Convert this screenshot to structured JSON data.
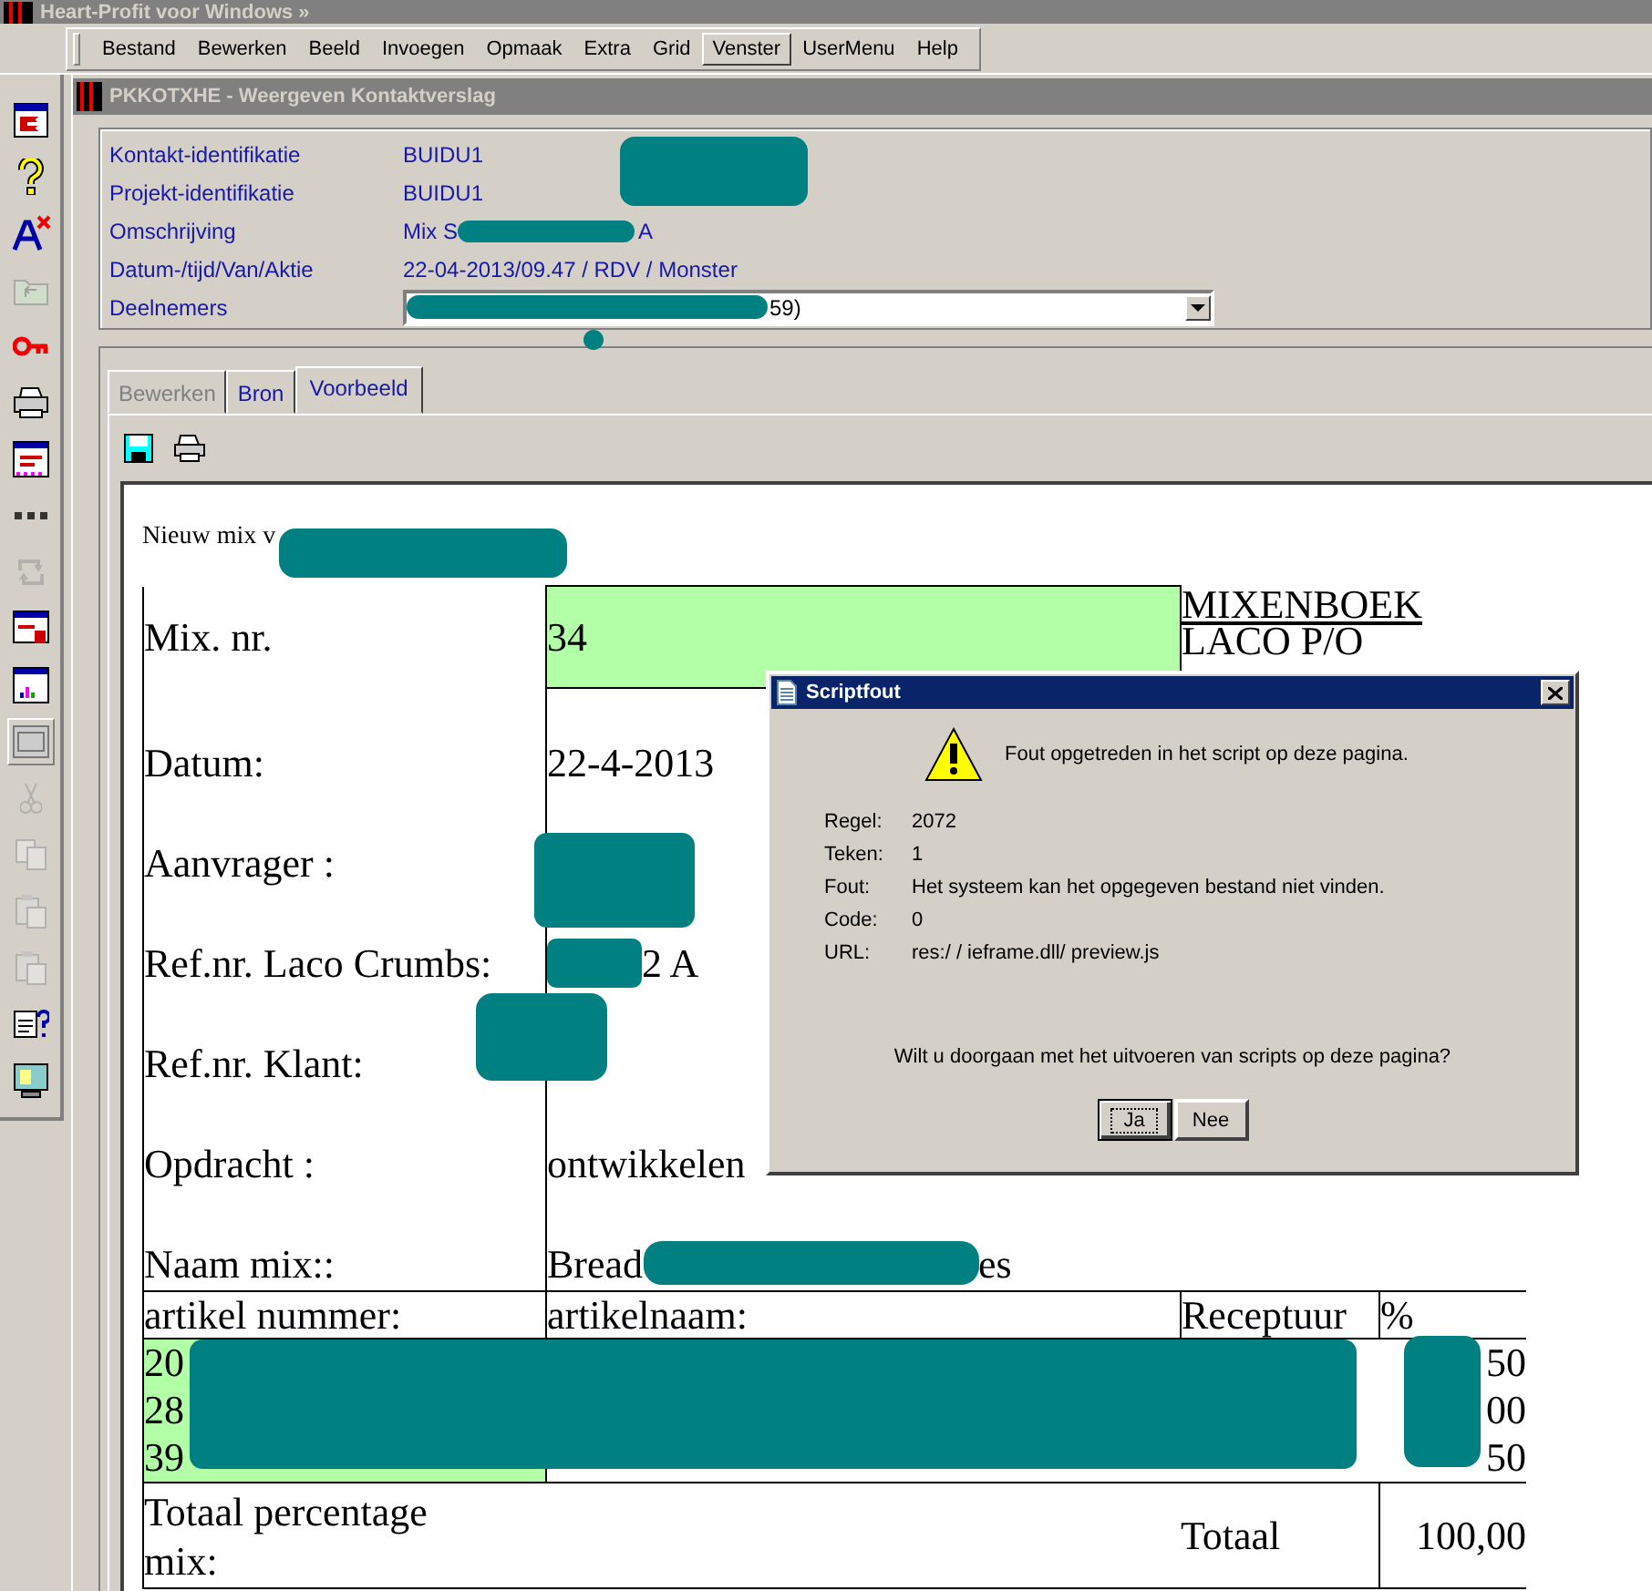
{
  "app_title": "Heart-Profit voor Windows »",
  "menu": [
    {
      "label": "Bestand",
      "selected": false
    },
    {
      "label": "Bewerken",
      "selected": false
    },
    {
      "label": "Beeld",
      "selected": false
    },
    {
      "label": "Invoegen",
      "selected": false
    },
    {
      "label": "Opmaak",
      "selected": false
    },
    {
      "label": "Extra",
      "selected": false
    },
    {
      "label": "Grid",
      "selected": false
    },
    {
      "label": "Venster",
      "selected": true
    },
    {
      "label": "UserMenu",
      "selected": false
    },
    {
      "label": "Help",
      "selected": false
    }
  ],
  "toolbar": [
    {
      "kind": "exit",
      "disabled": false
    },
    {
      "kind": "help",
      "disabled": false
    },
    {
      "kind": "font",
      "disabled": false
    },
    {
      "kind": "folder",
      "disabled": true
    },
    {
      "kind": "key",
      "disabled": false
    },
    {
      "kind": "printer",
      "disabled": false
    },
    {
      "kind": "form",
      "disabled": false
    },
    {
      "kind": "dots",
      "disabled": false
    },
    {
      "kind": "refresh",
      "disabled": true
    },
    {
      "kind": "lock",
      "disabled": false
    },
    {
      "kind": "chart",
      "disabled": false
    },
    {
      "kind": "window",
      "disabled": false
    },
    {
      "kind": "cut",
      "disabled": true
    },
    {
      "kind": "copy",
      "disabled": true
    },
    {
      "kind": "paste",
      "disabled": true
    },
    {
      "kind": "paste",
      "disabled": true
    },
    {
      "kind": "clipboard",
      "disabled": false
    },
    {
      "kind": "monitor",
      "disabled": false
    }
  ],
  "window": {
    "title": "PKKOTXHE - Weergeven Kontaktverslag"
  },
  "fields": [
    {
      "kind": "text",
      "label": "Kontakt-identifikatie",
      "value": "BUIDU1"
    },
    {
      "kind": "text",
      "label": "Projekt-identifikatie",
      "value": "BUIDU1"
    },
    {
      "kind": "redacted",
      "label": "Omschrijving",
      "value": "Mix S",
      "value_after": "A"
    },
    {
      "kind": "text",
      "label": "Datum-/tijd/Van/Aktie",
      "value": "22-04-2013/09.47 / RDV / Monster"
    },
    {
      "kind": "dropdown",
      "label": "Deelnemers",
      "value": "59)"
    }
  ],
  "tabs": [
    {
      "label": "Bewerken",
      "selected": false,
      "disabled": true
    },
    {
      "label": "Bron",
      "selected": false,
      "disabled": false
    },
    {
      "label": "Voorbeeld",
      "selected": true,
      "disabled": false
    }
  ],
  "preview": {
    "intro": "Nieuw mix v",
    "mix_label": "Mix. nr.",
    "mix_number": "34",
    "heading": "MIXENBOEK",
    "subheading": "LACO P/O",
    "rows": [
      {
        "label": "Datum:",
        "value": "22-4-2013"
      },
      {
        "label": "Aanvrager :"
      },
      {
        "label": "Ref.nr. Laco Crumbs:",
        "value": "2 A"
      },
      {
        "label": "Ref.nr. Klant:"
      },
      {
        "label": "Opdracht :",
        "value": "ontwikkelen"
      },
      {
        "label": "Naam mix::",
        "value": "Bread",
        "value_after": "es"
      }
    ],
    "columns": [
      "artikel nummer:",
      "artikelnaam:",
      "Receptuur",
      "%"
    ],
    "items": [
      {
        "number": "20",
        "percent": "50"
      },
      {
        "number": "28",
        "percent": "00"
      },
      {
        "number": "39",
        "percent": "50"
      }
    ],
    "total_label": "Totaal percentage mix:",
    "total_caption": "Totaal",
    "total": "100,00"
  },
  "dialog": {
    "title": "Scriptfout",
    "message": "Fout opgetreden in het script op deze pagina.",
    "details": [
      {
        "label": "Regel:",
        "value": "2072"
      },
      {
        "label": "Teken:",
        "value": "1"
      },
      {
        "label": "Fout:",
        "value": "Het systeem kan het opgegeven bestand niet vinden."
      },
      {
        "label": "Code:",
        "value": "0"
      },
      {
        "label": "URL:",
        "value": "res:/ / ieframe.dll/ preview.js"
      }
    ],
    "question": "Wilt u doorgaan met het uitvoeren van scripts op deze pagina?",
    "buttons": [
      {
        "label": "Ja",
        "focused": true
      },
      {
        "label": "Nee",
        "focused": false
      }
    ]
  }
}
